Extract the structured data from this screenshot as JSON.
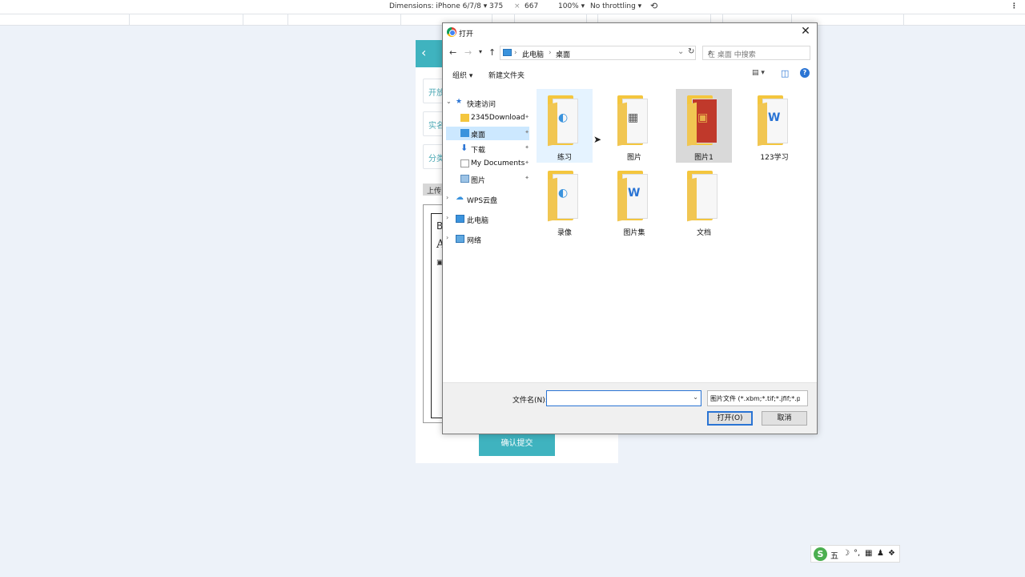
{
  "devtools": {
    "dimensions_label": "Dimensions: iPhone 6/7/8 ▾",
    "width": "375",
    "times": "×",
    "height": "667",
    "zoom": "100% ▾",
    "throttling": "No throttling ▾",
    "more": "⋮"
  },
  "mobile_page": {
    "back": "‹",
    "fields": [
      "开放",
      "实名",
      "分类"
    ],
    "upload_label": "上传",
    "editor_glyphs": [
      "B",
      "A"
    ],
    "submit_label": "确认提交"
  },
  "dialog": {
    "title": "打开",
    "close": "✕",
    "nav": {
      "back": "←",
      "forward": "→",
      "recent": "▾",
      "up": "↑"
    },
    "address": {
      "crumb1": "此电脑",
      "crumb2": "桌面",
      "sep": "›",
      "dropdown": "⌄",
      "refresh": "↻"
    },
    "search_placeholder": "在 桌面 中搜索",
    "toolbar": {
      "organize": "组织 ▾",
      "new_folder": "新建文件夹",
      "view": "▤ ▾",
      "pane": "◫",
      "help": "?"
    },
    "tree": [
      {
        "label": "快速访问",
        "arrow": "⌄"
      },
      {
        "label": "2345Download"
      },
      {
        "label": "桌面"
      },
      {
        "label": "下载"
      },
      {
        "label": "My Documents"
      },
      {
        "label": "图片"
      },
      {
        "label": "WPS云盘",
        "arrow": "›"
      },
      {
        "label": "此电脑",
        "arrow": "›"
      },
      {
        "label": "网络",
        "arrow": "›"
      }
    ],
    "pin": "📌",
    "files": [
      {
        "name": "练习",
        "glyph": "◐"
      },
      {
        "name": "图片",
        "glyph": "▦"
      },
      {
        "name": "图片1",
        "glyph": "▣"
      },
      {
        "name": "123学习",
        "glyph": "W"
      },
      {
        "name": "录像",
        "glyph": "◐"
      },
      {
        "name": "图片集",
        "glyph": "W"
      },
      {
        "name": "文档",
        "glyph": ""
      }
    ],
    "filename_label": "文件名(N):",
    "filename_value": "",
    "filetype": "图片文件 (*.xbm;*.tif;*.jfif;*.pjp",
    "dropdown": "⌄",
    "open_btn": "打开(O)",
    "cancel_btn": "取消"
  },
  "ime": {
    "logo": "S",
    "mode": "五",
    "moon": "☽",
    "punct": "°,",
    "keyboard": "▦",
    "user": "♟",
    "menu": "❖"
  },
  "colors": {
    "teal": "#3fb3bf",
    "accent": "#2a74d4",
    "folder": "#f4c63e"
  }
}
